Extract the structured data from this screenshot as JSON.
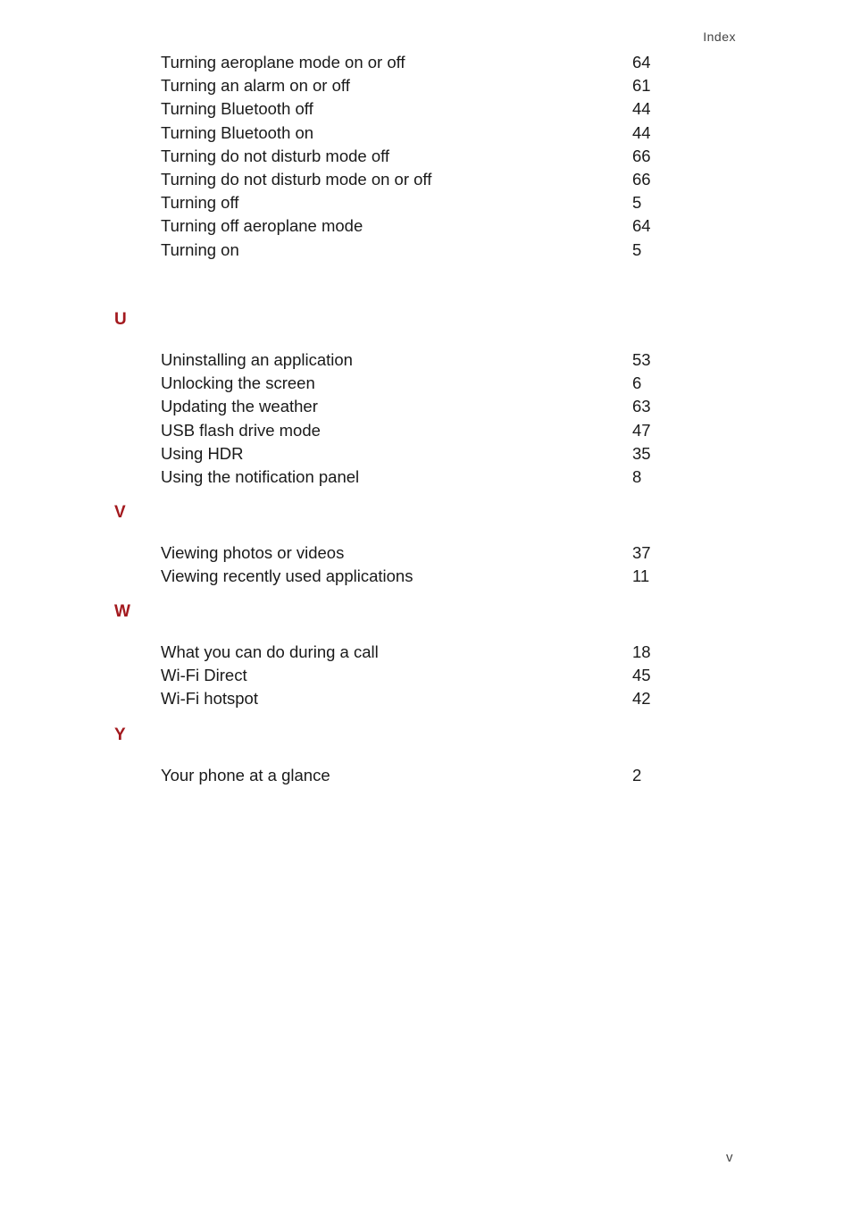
{
  "header": {
    "title": "Index"
  },
  "footer": {
    "page_number": "v"
  },
  "sections": [
    {
      "letter": "",
      "entries": [
        {
          "term": "Turning aeroplane mode on or off",
          "page": "64"
        },
        {
          "term": "Turning an alarm on or off",
          "page": "61"
        },
        {
          "term": "Turning Bluetooth off",
          "page": "44"
        },
        {
          "term": "Turning Bluetooth on",
          "page": "44"
        },
        {
          "term": "Turning do not disturb mode off",
          "page": "66"
        },
        {
          "term": "Turning do not disturb mode on or off",
          "page": "66"
        },
        {
          "term": "Turning off",
          "page": "5"
        },
        {
          "term": "Turning off aeroplane mode",
          "page": "64"
        },
        {
          "term": "Turning on",
          "page": "5"
        }
      ]
    },
    {
      "letter": "U",
      "entries": [
        {
          "term": "Uninstalling an application",
          "page": "53"
        },
        {
          "term": "Unlocking the screen",
          "page": "6"
        },
        {
          "term": "Updating the weather",
          "page": "63"
        },
        {
          "term": "USB flash drive mode",
          "page": "47"
        },
        {
          "term": "Using HDR",
          "page": "35"
        },
        {
          "term": "Using the notification panel",
          "page": "8"
        }
      ]
    },
    {
      "letter": "V",
      "entries": [
        {
          "term": "Viewing photos or videos",
          "page": "37"
        },
        {
          "term": "Viewing recently used applications",
          "page": "11"
        }
      ]
    },
    {
      "letter": "W",
      "entries": [
        {
          "term": "What you can do during a call",
          "page": "18"
        },
        {
          "term": "Wi-Fi Direct",
          "page": "45"
        },
        {
          "term": "Wi-Fi hotspot",
          "page": "42"
        }
      ]
    },
    {
      "letter": "Y",
      "entries": [
        {
          "term": "Your phone at a glance",
          "page": "2"
        }
      ]
    }
  ],
  "colors": {
    "section_letter": "#a3191e",
    "text": "#1a1a1a"
  }
}
